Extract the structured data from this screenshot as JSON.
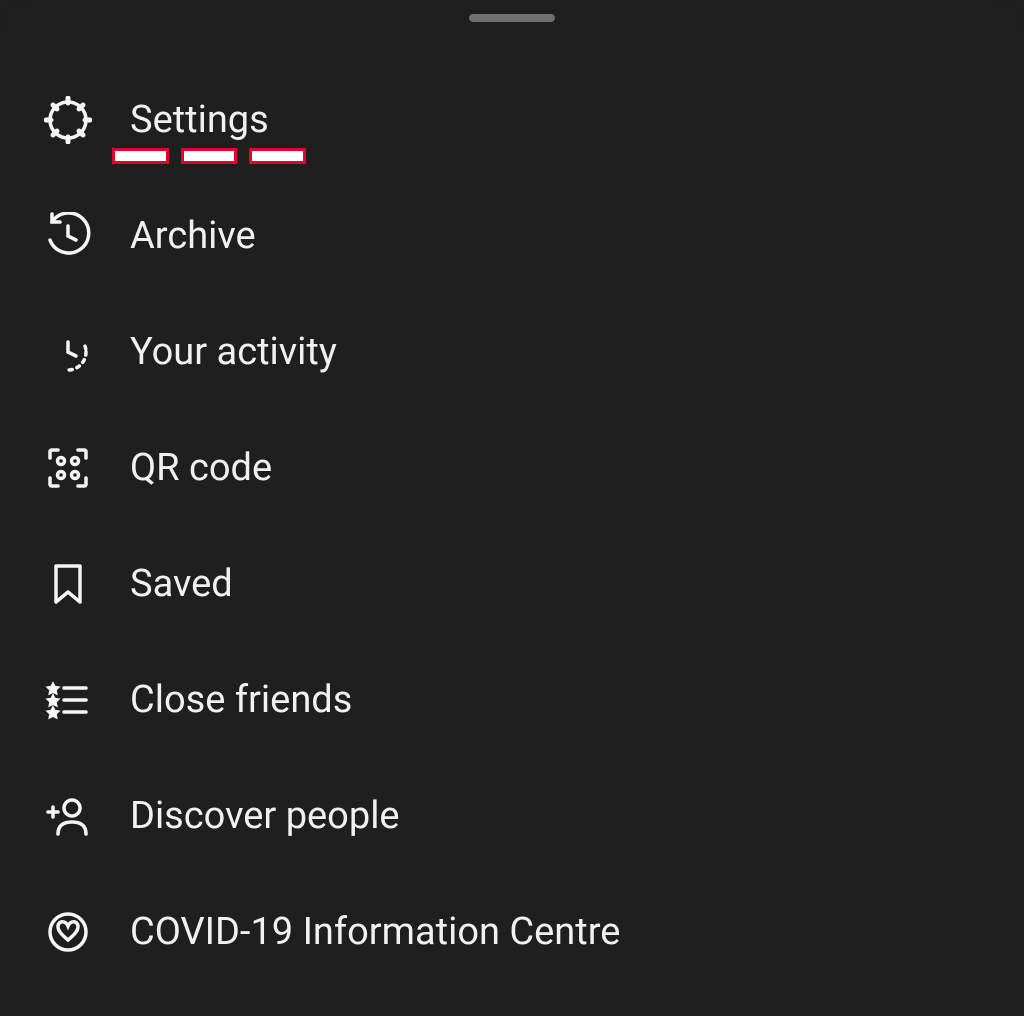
{
  "menu": {
    "items": [
      {
        "label": "Settings",
        "name": "settings",
        "icon": "gear-icon",
        "highlighted": true
      },
      {
        "label": "Archive",
        "name": "archive",
        "icon": "archive-clock-icon",
        "highlighted": false
      },
      {
        "label": "Your activity",
        "name": "your-activity",
        "icon": "activity-clock-icon",
        "highlighted": false
      },
      {
        "label": "QR code",
        "name": "qr-code",
        "icon": "qr-code-icon",
        "highlighted": false
      },
      {
        "label": "Saved",
        "name": "saved",
        "icon": "bookmark-icon",
        "highlighted": false
      },
      {
        "label": "Close friends",
        "name": "close-friends",
        "icon": "star-list-icon",
        "highlighted": false
      },
      {
        "label": "Discover people",
        "name": "discover-people",
        "icon": "add-person-icon",
        "highlighted": false
      },
      {
        "label": "COVID-19 Information Centre",
        "name": "covid-info",
        "icon": "heart-badge-icon",
        "highlighted": false
      }
    ]
  },
  "colors": {
    "background": "#1f1f1f",
    "text": "#f1f1f1",
    "grabber": "#6f6f6f",
    "highlight": "#e4002b"
  }
}
